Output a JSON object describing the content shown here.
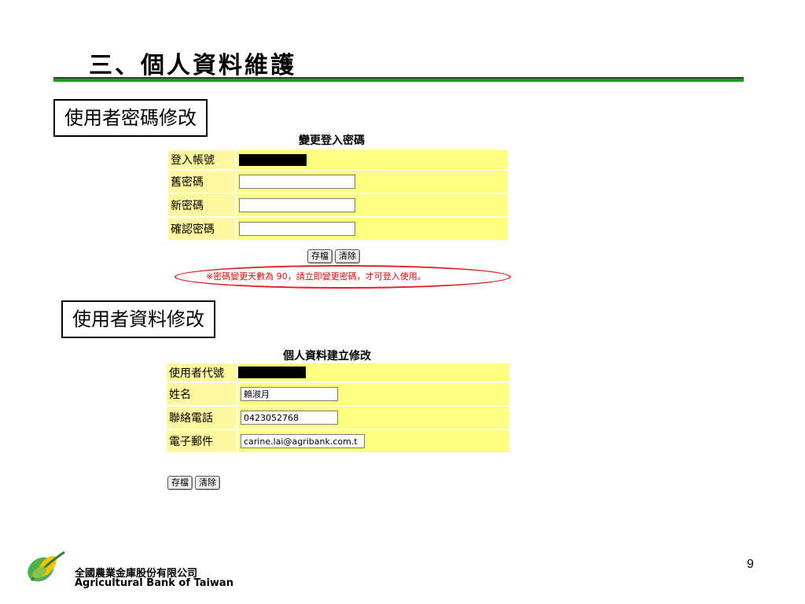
{
  "slide": {
    "title": "三、個人資料維護",
    "page_number": "9"
  },
  "password_section": {
    "heading": "使用者密碼修改",
    "form_title": "變更登入密碼",
    "fields": [
      {
        "label": "登入帳號",
        "value": "",
        "masked": true
      },
      {
        "label": "舊密碼",
        "value": ""
      },
      {
        "label": "新密碼",
        "value": ""
      },
      {
        "label": "確認密碼",
        "value": ""
      }
    ],
    "save_label": "存檔",
    "clear_label": "清除",
    "notice": "※密碼變更天數為 90，請立即變更密碼，才可登入使用。"
  },
  "profile_section": {
    "heading": "使用者資料修改",
    "form_title": "個人資料建立修改",
    "fields": [
      {
        "label": "使用者代號",
        "value": "",
        "masked": true
      },
      {
        "label": "姓名",
        "value": "賴淑月"
      },
      {
        "label": "聯絡電話",
        "value": "0423052768"
      },
      {
        "label": "電子郵件",
        "value": "carine.lai@agribank.com.t"
      }
    ],
    "save_label": "存檔",
    "clear_label": "清除"
  },
  "footer": {
    "company_cn": "全國農業金庫股份有限公司",
    "company_en": "Agricultural Bank of Taiwan",
    "logo_icon": "agricultural-bank-logo-icon"
  },
  "colors": {
    "accent_green": "#1f9a1f",
    "label_cell": "#fff8a0",
    "value_cell": "#ffff80",
    "notice_red": "#d01010"
  }
}
